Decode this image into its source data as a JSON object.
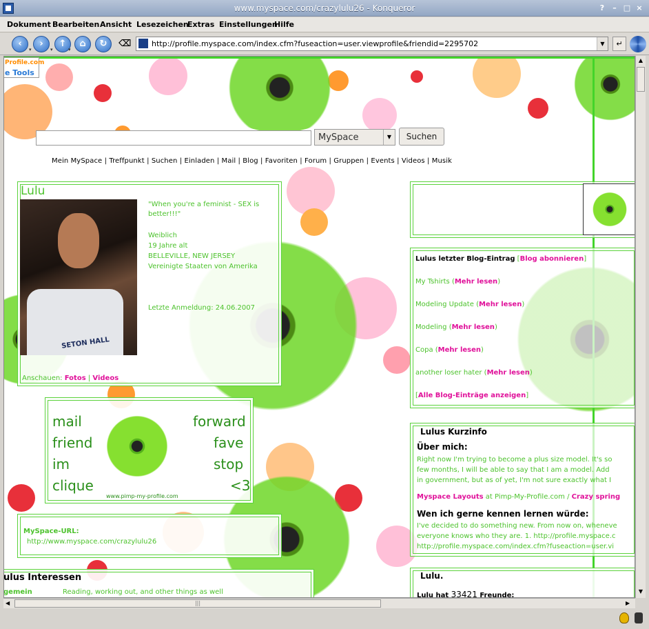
{
  "window": {
    "title": "www.myspace.com/crazylulu26 - Konqueror",
    "controls": [
      "?",
      "–",
      "□",
      "×"
    ]
  },
  "menu": [
    "Dokument",
    "Bearbeiten",
    "Ansicht",
    "Lesezeichen",
    "Extras",
    "Einstellungen",
    "Hilfe"
  ],
  "toolbar": {
    "url": "http://profile.myspace.com/index.cfm?fuseaction=user.viewprofile&friendid=2295702"
  },
  "badge": {
    "line1": "Profile.com",
    "line2": "e Tools"
  },
  "search": {
    "select": "MySpace",
    "button": "Suchen"
  },
  "nav": [
    "Mein MySpace",
    "Treffpunkt",
    "Suchen",
    "Einladen",
    "Mail",
    "Blog",
    "Favoriten",
    "Forum",
    "Gruppen",
    "Events",
    "Videos",
    "Musik"
  ],
  "profile": {
    "name": "Lulu",
    "quote": "\"When you're a feminist - SEX is better!!!\"",
    "gender": "Weiblich",
    "age": "19 Jahre alt",
    "city": "BELLEVILLE, NEW JERSEY",
    "country": "Vereinigte Staaten von Amerika",
    "last_login": "Letzte Anmeldung: 24.06.2007",
    "view_label": "Anschauen:",
    "photos": "Fotos",
    "videos": "Videos",
    "shirt_text": "SETON HALL"
  },
  "contact": {
    "mail": "mail",
    "forward": "forward",
    "friend": "friend",
    "fave": "fave",
    "im": "im",
    "stop": "stop",
    "clique": "clique",
    "lt3": "<3",
    "credit": "www.pimp-my-profile.com"
  },
  "url_box": {
    "label": "MySpace-URL:",
    "value": "http://www.myspace.com/crazylulu26"
  },
  "interests": {
    "title": "ulus Interessen",
    "row_label": "gemein",
    "row_value": "Reading, working out, and other things as well"
  },
  "blog": {
    "title": "Lulus letzter Blog-Eintrag",
    "subscribe": "Blog abonnieren",
    "entries": [
      "My Tshirts",
      "Modeling Update",
      "Modeling",
      "Copa",
      "another loser hater"
    ],
    "more": "Mehr lesen",
    "all": "Alle Blog-Einträge anzeigen"
  },
  "info": {
    "title": "Lulus Kurzinfo",
    "about_h": "Über mich:",
    "about_1": "Right now I'm trying to become a plus size model. It's so",
    "about_2": "few months, I will be able to say that I am a model. Add",
    "about_3": "in government, but as of yet, I'm not sure exactly what I",
    "layouts_a": "Myspace Layouts",
    "layouts_b": "at Pimp-My-Profile.com /",
    "layouts_c": "Crazy spring",
    "meet_h": "Wen ich gerne kennen lernen würde:",
    "meet_1": "I've decided to do something new. From now on, wheneve",
    "meet_2": "everyone knows who they are. 1. http://profile.myspace.c",
    "meet_3": "http://profile.myspace.com/index.cfm?fuseaction=user.vi"
  },
  "friends": {
    "title": "Lulu.",
    "prefix": "Lulu hat",
    "count": "33421",
    "suffix": "Freunde:"
  }
}
